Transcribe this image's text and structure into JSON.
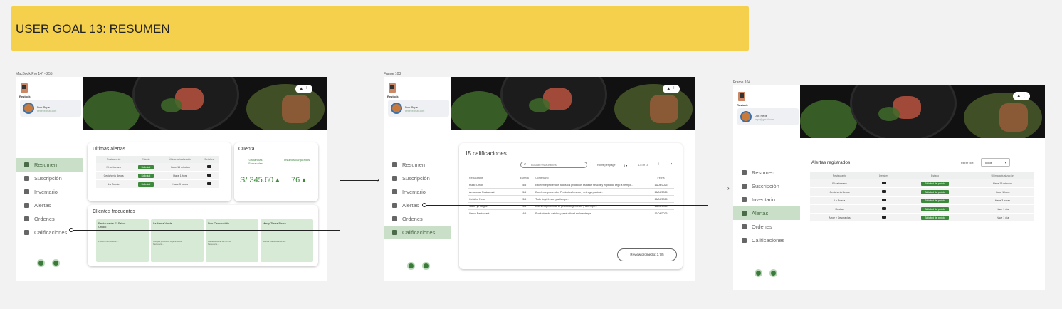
{
  "banner": {
    "title": "USER GOAL 13: RESUMEN"
  },
  "frames": [
    {
      "label": "MacBook Pro 14\" - 255"
    },
    {
      "label": "Frame 103"
    },
    {
      "label": "Frame 104"
    }
  ],
  "app": {
    "logo_text": "Restock",
    "user_name": "Don Pepe",
    "user_email": "pepe@gmail.com"
  },
  "nav": [
    "Resumen",
    "Suscripción",
    "Inventario",
    "Alertas",
    "Ordenes",
    "Calificaciones"
  ],
  "hero_btn": {
    "user": "▲",
    "more": "⋮"
  },
  "f1": {
    "alerts_title": "Ultimas alertas",
    "alerts_headers": [
      "Restaurante",
      "Estado",
      "Última actualización",
      "Detalles"
    ],
    "alerts_rows": [
      [
        "El carbonaro",
        "Solicitud",
        "Hace 15 minutos"
      ],
      [
        "Cevichería Beto's",
        "Solicitud",
        "Hace 1 hora"
      ],
      [
        "La Rueda",
        "Solicitud",
        "Hace 3 horas"
      ]
    ],
    "account_title": "Cuenta",
    "account_l1": "Ganancias Semanales",
    "account_l2": "Insumos cargurados",
    "account_v1": "S/ 345.60",
    "account_v2": "76",
    "clients_title": "Clientes frecuentes",
    "clients": [
      {
        "name": "Restaurante El Sabor Criollo",
        "desc": "Pedido más reciente ..."
      },
      {
        "name": "La Mesa Verde",
        "desc": "Compra productos orgánicos con frecuencia..."
      },
      {
        "name": "Don Carbonchito",
        "desc": "Adquiere carne de res con frecuencia..."
      },
      {
        "name": "Mar y Tierra Bistro",
        "desc": "Solicita mariscos frescos..."
      }
    ]
  },
  "f2": {
    "title": "15 calificaciones",
    "search_placeholder": "Buscar restaurantes",
    "rows_per_page": "Rows per page",
    "rpp_val": "5",
    "page_info": "1-5 of 15",
    "headers": [
      "Restaurante",
      "Estrella",
      "Comentario",
      "Fecha"
    ],
    "rows": [
      [
        "Punto Limón",
        "5/5",
        "Excelente proveedor, todos los productos estaban frescos y el pedido llegó a tiempo...",
        "16/04/2025"
      ],
      [
        "Amazonas Restaurant",
        "5/5",
        "Excelente proveedor. Productos frescos y entrega puntual...",
        "16/04/2025"
      ],
      [
        "Cebiche Peru",
        "3/5",
        "Todo llegó fresco y a tiempo...",
        "16/04/2025"
      ],
      [
        "Sabor y Fuegos",
        "3/5",
        "Buena experiencia. El pedido llegó fresco y a tiempo...",
        "16/04/2025"
      ],
      [
        "Limon Restaurant",
        "4/5",
        "Productos de calidad y puntualidad en la entrega...",
        "16/04/2025"
      ]
    ],
    "avg": "Review promedio: 3.7/5"
  },
  "f3": {
    "title": "Alertas registrados",
    "filter_label": "Filtrar por:",
    "filter_val": "Todos",
    "headers": [
      "Restaurante",
      "Detalles",
      "Estado",
      "Última actualización"
    ],
    "rows": [
      [
        "El carbonaro",
        "Solicitud de pedido",
        "Hace 15 minutos"
      ],
      [
        "Cevichería Beto's",
        "Solicitud de pedido",
        "Hace 1 hora"
      ],
      [
        "La Rueda",
        "Solicitud de pedido",
        "Hace 3 horas"
      ],
      [
        "Rustica",
        "Solicitud de pedido",
        "Hace 1 día"
      ],
      [
        "Arroz y Desgracias",
        "Solicitud de pedido",
        "Hace 1 día"
      ]
    ]
  }
}
